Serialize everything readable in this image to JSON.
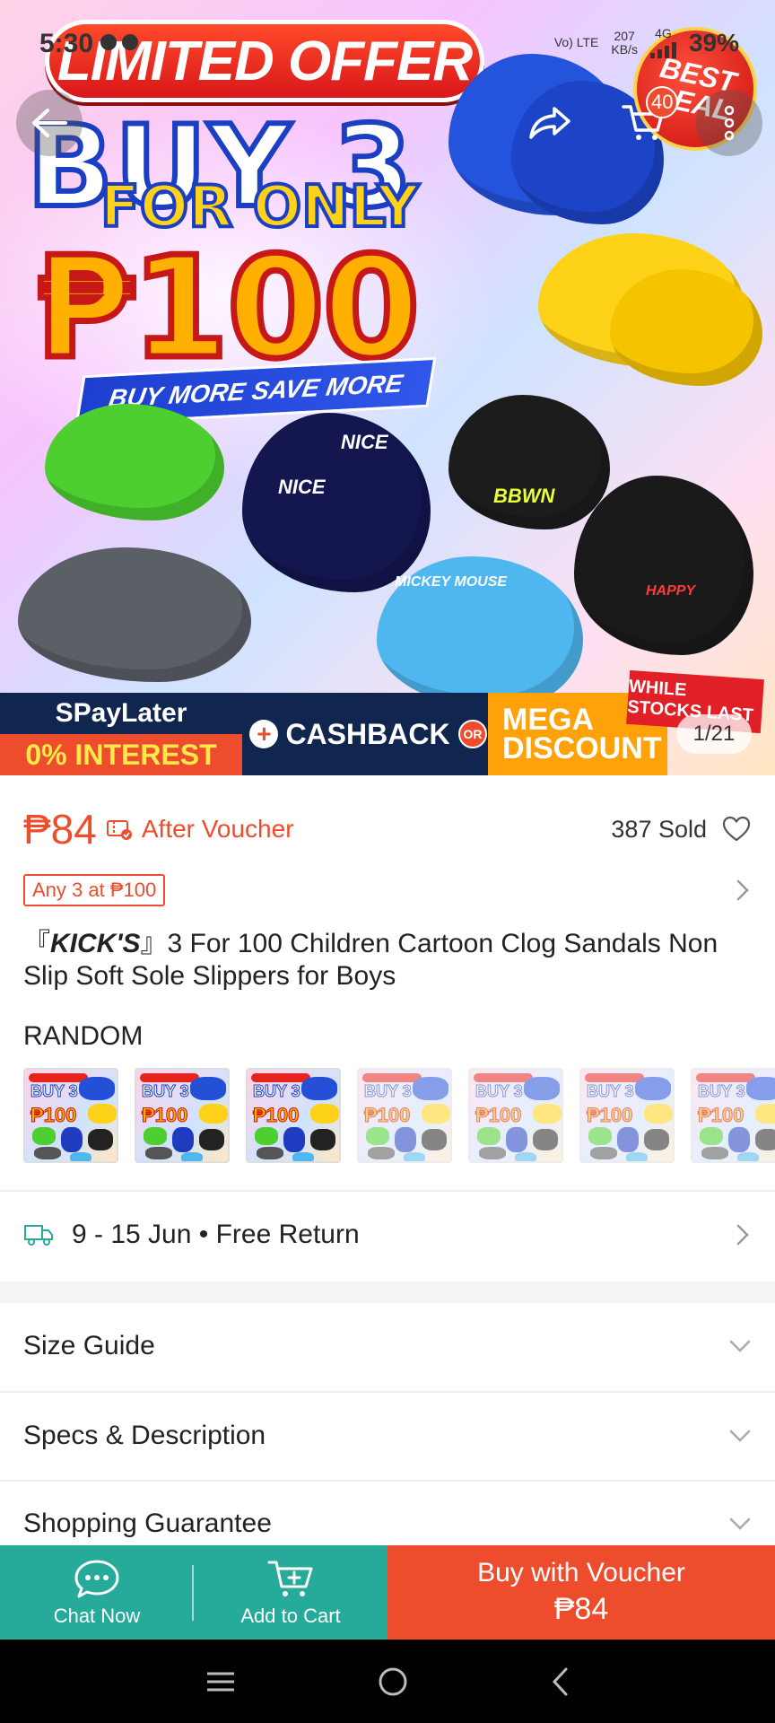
{
  "status_bar": {
    "time": "5:30",
    "network_top": "207",
    "network_unit": "KB/s",
    "lte": "Vo) LTE",
    "signal": "4G",
    "battery": "39%"
  },
  "header": {
    "cart_count": "40"
  },
  "banner": {
    "offer": "LIMITED OFFER",
    "headline": "BUY 3",
    "subline": "FOR ONLY",
    "price": "₱100",
    "tagline": "BUY MORE SAVE MORE",
    "badge": "BEST DEAL",
    "shoe_labels": [
      "NICE",
      "NICE",
      "BBWN",
      "MICKEY MOUSE",
      "HAPPY"
    ],
    "spaylater": "SPayLater",
    "interest": "0% INTEREST",
    "cashback": "CASHBACK",
    "or": "OR",
    "mega": "MEGA",
    "discount": "DISCOUNT",
    "while_stocks": "WHILE STOCKS LAST",
    "page_indicator": "1/21"
  },
  "product": {
    "price": "₱84",
    "after_voucher": "After Voucher",
    "sold": "387 Sold",
    "deal_tag": "Any 3 at ₱100",
    "brand_open": "『",
    "brand": "KICK'S",
    "brand_close": "』",
    "title_rest": "3 For 100 Children Cartoon Clog Sandals Non Slip Soft Sole Slippers for Boys",
    "variant_label": "RANDOM",
    "thumb_buy": "BUY 3",
    "thumb_price": "₱100",
    "thumbnails_count": 7
  },
  "shipping": {
    "text": "9 - 15 Jun • Free Return"
  },
  "sections": [
    {
      "title": "Size Guide"
    },
    {
      "title": "Specs & Description"
    },
    {
      "title": "Shopping Guarantee"
    }
  ],
  "action_bar": {
    "chat": "Chat Now",
    "cart": "Add to Cart",
    "buy_line1": "Buy with Voucher",
    "buy_line2": "₱84"
  },
  "colors": {
    "accent": "#ee4d2d",
    "chat_green": "#26aa99",
    "nav_bg": "#000000"
  }
}
